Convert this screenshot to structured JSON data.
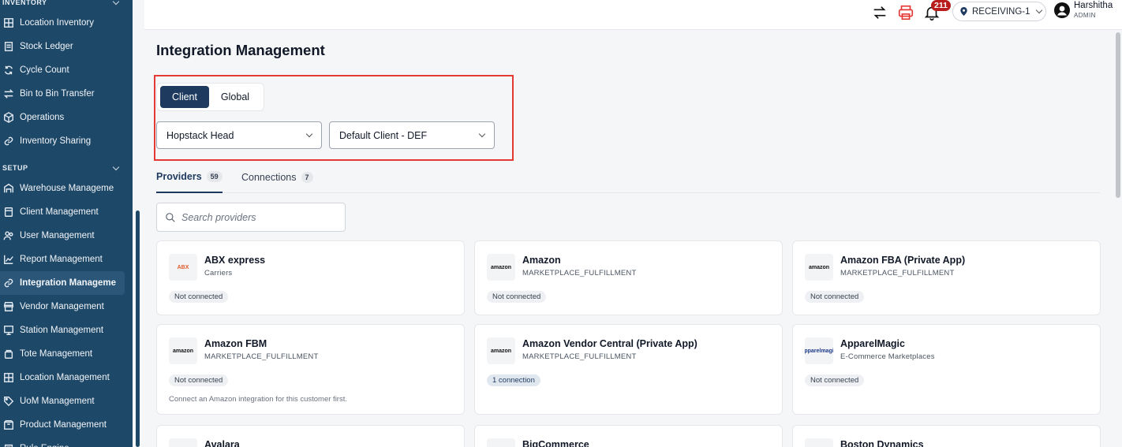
{
  "sidebar": {
    "sections": {
      "inventory": "INVENTORY",
      "setup": "SETUP"
    },
    "inventory_items": [
      {
        "label": "Location Inventory",
        "icon": "grid-icon"
      },
      {
        "label": "Stock Ledger",
        "icon": "ledger-icon"
      },
      {
        "label": "Cycle Count",
        "icon": "refresh-icon"
      },
      {
        "label": "Bin to Bin Transfer",
        "icon": "transfer-icon"
      },
      {
        "label": "Operations",
        "icon": "cube-icon"
      },
      {
        "label": "Inventory Sharing",
        "icon": "link-icon"
      }
    ],
    "setup_items": [
      {
        "label": "Warehouse Manageme",
        "icon": "warehouse-icon"
      },
      {
        "label": "Client Management",
        "icon": "document-icon"
      },
      {
        "label": "User Management",
        "icon": "users-icon"
      },
      {
        "label": "Report Management",
        "icon": "chart-icon"
      },
      {
        "label": "Integration Manageme",
        "icon": "link-icon",
        "active": true
      },
      {
        "label": "Vendor Management",
        "icon": "store-icon"
      },
      {
        "label": "Station Management",
        "icon": "monitor-icon"
      },
      {
        "label": "Tote Management",
        "icon": "tote-icon"
      },
      {
        "label": "Location Management",
        "icon": "grid-icon"
      },
      {
        "label": "UoM Management",
        "icon": "tag-icon"
      },
      {
        "label": "Product Management",
        "icon": "box-icon"
      },
      {
        "label": "Rule Engine",
        "icon": "rule-icon"
      }
    ]
  },
  "topbar": {
    "notification_count": "211",
    "location": "RECEIVING-1",
    "user_name": "Harshitha",
    "user_role": "ADMIN",
    "icons": [
      "swap-icon",
      "printer-icon",
      "bell-icon",
      "location-pin-icon",
      "user-avatar-icon"
    ],
    "accent_color": "#e53935"
  },
  "main": {
    "title": "Integration Management",
    "scope_toggle": {
      "client": "Client",
      "global": "Global",
      "selected": "Client"
    },
    "warehouse_select": "Hopstack Head",
    "client_select": "Default Client - DEF",
    "tabs": [
      {
        "label": "Providers",
        "count": "59",
        "active": true
      },
      {
        "label": "Connections",
        "count": "7",
        "active": false
      }
    ],
    "search": {
      "placeholder": "Search providers",
      "value": ""
    },
    "providers": [
      {
        "name": "ABX express",
        "category": "Carriers",
        "status": "Not connected",
        "logo": "ABX",
        "logo_color": "#e05a2b"
      },
      {
        "name": "Amazon",
        "category": "MARKETPLACE_FULFILLMENT",
        "status": "Not connected",
        "logo": "amazon",
        "logo_color": "#111111"
      },
      {
        "name": "Amazon FBA (Private App)",
        "category": "MARKETPLACE_FULFILLMENT",
        "status": "Not connected",
        "logo": "amazon",
        "logo_color": "#111111"
      },
      {
        "name": "Amazon FBM",
        "category": "MARKETPLACE_FULFILLMENT",
        "status": "Not connected",
        "note": "Connect an Amazon integration for this customer first.",
        "logo": "amazon",
        "logo_color": "#111111"
      },
      {
        "name": "Amazon Vendor Central (Private App)",
        "category": "MARKETPLACE_FULFILLMENT",
        "status": "1 connection",
        "logo": "amazon",
        "logo_color": "#111111"
      },
      {
        "name": "ApparelMagic",
        "category": "E-Commerce Marketplaces",
        "status": "Not connected",
        "logo": "apparelmagic",
        "logo_color": "#1e3a8a"
      },
      {
        "name": "Avalara",
        "category": "",
        "status": "",
        "logo": "",
        "logo_color": "#111111"
      },
      {
        "name": "BigCommerce",
        "category": "",
        "status": "",
        "logo": "",
        "logo_color": "#111111"
      },
      {
        "name": "Boston Dynamics",
        "category": "",
        "status": "",
        "logo": "",
        "logo_color": "#111111"
      }
    ]
  }
}
